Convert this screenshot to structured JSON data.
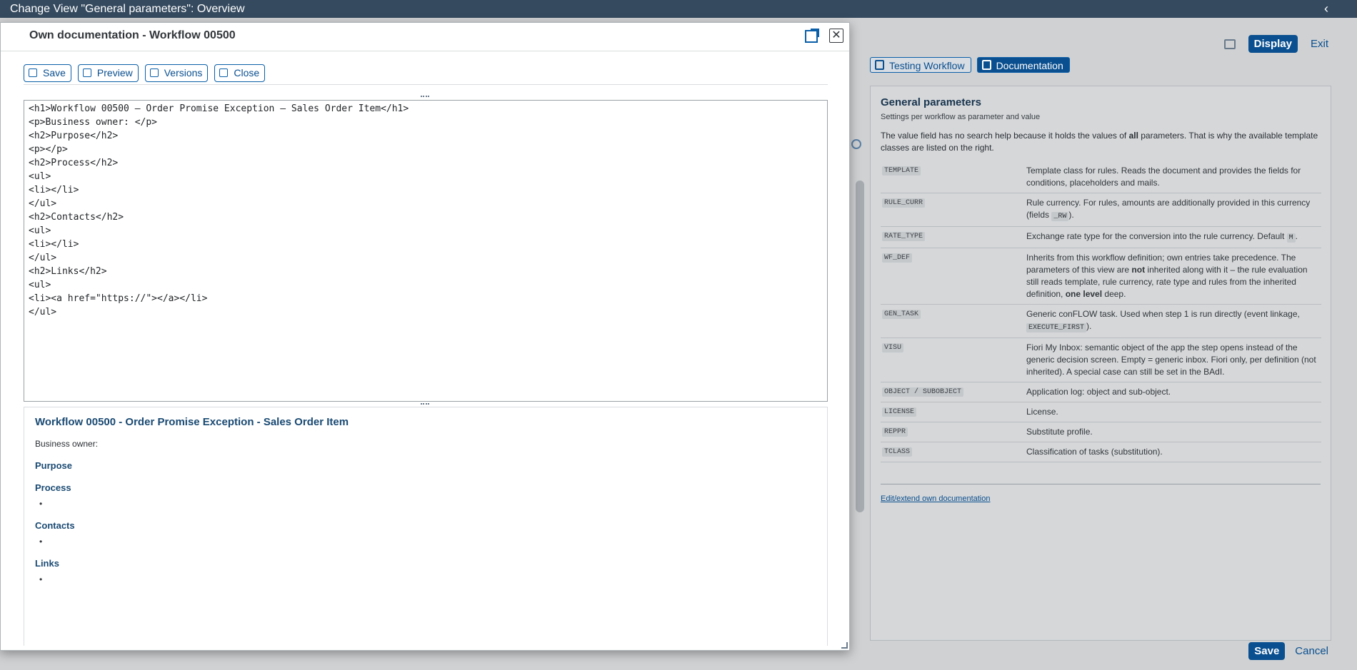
{
  "shell": {
    "title": "Change View \"General parameters\": Overview",
    "back_glyph": "‹"
  },
  "page": {
    "actions": {
      "display": "Display",
      "exit": "Exit"
    },
    "footer": {
      "save": "Save",
      "cancel": "Cancel"
    },
    "tabs": [
      {
        "label": "Testing Workflow",
        "icon": "workflow-icon",
        "active": false
      },
      {
        "label": "Documentation",
        "icon": "info-icon",
        "active": true
      }
    ]
  },
  "doc_panel": {
    "title": "General parameters",
    "subtitle": "Settings per workflow as parameter and value",
    "intro_pre": "The value field has no search help because it holds the values of ",
    "intro_bold": "all",
    "intro_post": " parameters. That is why the available template classes are listed on the right.",
    "params": [
      {
        "key": "TEMPLATE",
        "desc": "Template class for rules. Reads the document and provides the fields for conditions, placeholders and mails."
      },
      {
        "key": "RULE_CURR",
        "desc_pre": "Rule currency. For rules, amounts are additionally provided in this currency (fields ",
        "code": "_RW",
        "desc_post": ")."
      },
      {
        "key": "RATE_TYPE",
        "desc_pre": "Exchange rate type for the conversion into the rule currency. Default ",
        "code": "M",
        "desc_post": "."
      },
      {
        "key": "WF_DEF",
        "desc_pre": "Inherits from this workflow definition; own entries take precedence. The parameters of this view are ",
        "bold1": "not",
        "desc_mid": " inherited along with it – the rule evaluation still reads template, rule currency, rate type and rules from the inherited definition, ",
        "bold2": "one level",
        "desc_post": " deep."
      },
      {
        "key": "GEN_TASK",
        "desc_pre": "Generic conFLOW task. Used when step 1 is run directly (event linkage, ",
        "code": "EXECUTE_FIRST",
        "desc_post": ")."
      },
      {
        "key": "VISU",
        "desc": "Fiori My Inbox: semantic object of the app the step opens instead of the generic decision screen. Empty = generic inbox. Fiori only, per definition (not inherited). A special case can still be set in the BAdI."
      },
      {
        "key": "OBJECT / SUBOBJECT",
        "desc": "Application log: object and sub-object."
      },
      {
        "key": "LICENSE",
        "desc": "License."
      },
      {
        "key": "REPPR",
        "desc": "Substitute profile."
      },
      {
        "key": "TCLASS",
        "desc": "Classification of tasks (substitution)."
      }
    ],
    "edit_link": "Edit/extend own documentation"
  },
  "dialog": {
    "title": "Own documentation - Workflow 00500",
    "toolbar": [
      {
        "label": "Save",
        "icon": "save-icon"
      },
      {
        "label": "Preview",
        "icon": "glasses-icon"
      },
      {
        "label": "Versions",
        "icon": "versions-icon"
      },
      {
        "label": "Close",
        "icon": "close-icon"
      }
    ],
    "editor_text": "<h1>Workflow 00500 – Order Promise Exception – Sales Order Item</h1>\n<p>Business owner: </p>\n<h2>Purpose</h2>\n<p></p>\n<h2>Process</h2>\n<ul>\n<li></li>\n</ul>\n<h2>Contacts</h2>\n<ul>\n<li></li>\n</ul>\n<h2>Links</h2>\n<ul>\n<li><a href=\"https://\"></a></li>\n</ul>",
    "preview": {
      "h1": "Workflow 00500 - Order Promise Exception - Sales Order Item",
      "business_owner": "Business owner:",
      "sections": [
        "Purpose",
        "Process",
        "Contacts",
        "Links"
      ]
    }
  },
  "colors": {
    "shell": "#354a5f",
    "accent": "#0a4f8f",
    "heading": "#1a4a73"
  }
}
